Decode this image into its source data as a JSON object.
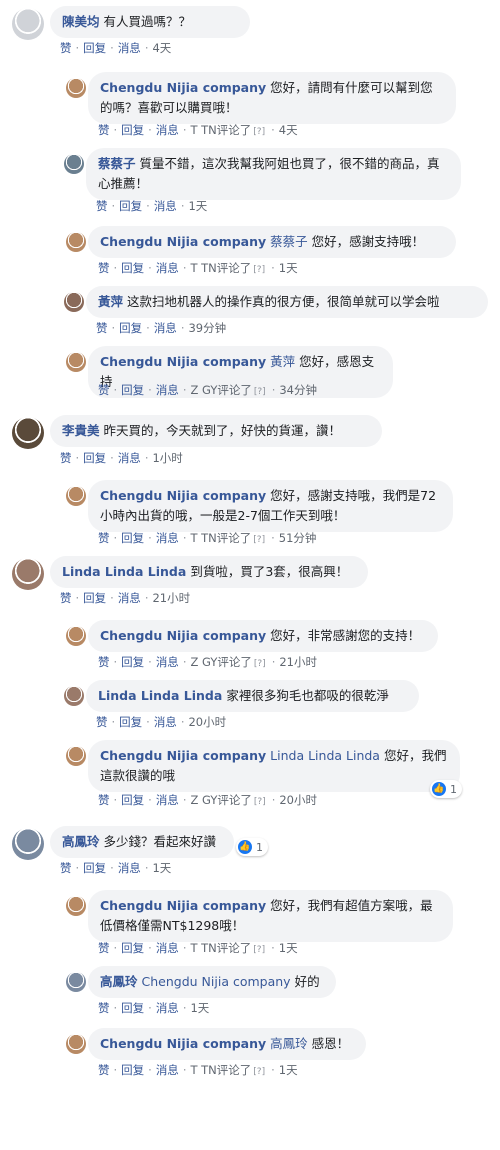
{
  "labels": {
    "like": "赞",
    "reply": "回复",
    "message": "消息"
  },
  "colors": {
    "bubble": "#f2f3f5",
    "name": "#385898",
    "meta": "#606770",
    "like_badge": "#1877f2"
  },
  "icons": {
    "avatar": "avatar-image",
    "reaction": "like-icon"
  },
  "comments": [
    {
      "name": "陳美均",
      "text": "有人買過嗎？？",
      "time": "4天",
      "avatar_color": "#d0d3d8"
    },
    {
      "name": "Chengdu Nijia company",
      "text": "您好，請問有什麼可以幫到您的嗎？喜歡可以購買哦！",
      "editor": "T TN评论了",
      "editor_mark": "[?]",
      "time": "4天",
      "avatar_color": "#b88a64"
    },
    {
      "name": "蔡蔡子",
      "text": "質量不錯，這次我幫我阿姐也買了，很不錯的商品，真心推薦！",
      "time": "1天",
      "avatar_color": "#6a7f90"
    },
    {
      "name": "Chengdu Nijia company",
      "tag": "蔡蔡子",
      "text": "您好，感謝支持哦！",
      "editor": "T TN评论了",
      "editor_mark": "[?]",
      "time": "1天",
      "avatar_color": "#b88a64"
    },
    {
      "name": "黃萍",
      "text": "这款扫地机器人的操作真的很方便，很简单就可以学会啦",
      "time": "39分钟",
      "avatar_color": "#8a6a5a"
    },
    {
      "name": "Chengdu Nijia company",
      "tag": "黃萍",
      "text": "您好，感恩支持",
      "editor": "Z GY评论了",
      "editor_mark": "[?]",
      "time": "34分钟",
      "avatar_color": "#b88a64"
    },
    {
      "name": "李貴美",
      "text": "昨天買的，今天就到了，好快的貨運，讚！",
      "time": "1小时",
      "avatar_color": "#5a4a3a"
    },
    {
      "name": "Chengdu Nijia company",
      "text": "您好，感謝支持哦，我們是72小時內出貨的哦，一般是2-7個工作天到哦！",
      "editor": "T TN评论了",
      "editor_mark": "[?]",
      "time": "51分钟",
      "avatar_color": "#b88a64"
    },
    {
      "name": "Linda Linda Linda",
      "text": "到貨啦，買了3套，很高興！",
      "time": "21小时",
      "avatar_color": "#9a7a6a"
    },
    {
      "name": "Chengdu Nijia company",
      "text": "您好，非常感謝您的支持！",
      "editor": "Z GY评论了",
      "editor_mark": "[?]",
      "time": "21小时",
      "avatar_color": "#b88a64"
    },
    {
      "name": "Linda Linda Linda",
      "text": "家裡很多狗毛也都吸的很乾淨",
      "time": "20小时",
      "avatar_color": "#9a7a6a"
    },
    {
      "name": "Chengdu Nijia company",
      "tag": "Linda Linda Linda",
      "text": "您好，我們這款很讚的哦",
      "editor": "Z GY评论了",
      "editor_mark": "[?]",
      "time": "20小时",
      "reactions": "1",
      "avatar_color": "#b88a64"
    },
    {
      "name": "高鳳玲",
      "text": "多少錢？看起來好讚",
      "time": "1天",
      "reactions": "1",
      "avatar_color": "#7a8aa0"
    },
    {
      "name": "Chengdu Nijia company",
      "text": "您好，我們有超值方案哦，最低價格僅需NT$1298哦！",
      "editor": "T TN评论了",
      "editor_mark": "[?]",
      "time": "1天",
      "avatar_color": "#b88a64"
    },
    {
      "name": "高鳳玲",
      "tag": "Chengdu Nijia company",
      "text": "好的",
      "time": "1天",
      "avatar_color": "#7a8aa0"
    },
    {
      "name": "Chengdu Nijia company",
      "tag": "高鳳玲",
      "text": "感恩！",
      "editor": "T TN评论了",
      "editor_mark": "[?]",
      "time": "1天",
      "avatar_color": "#b88a64"
    }
  ]
}
